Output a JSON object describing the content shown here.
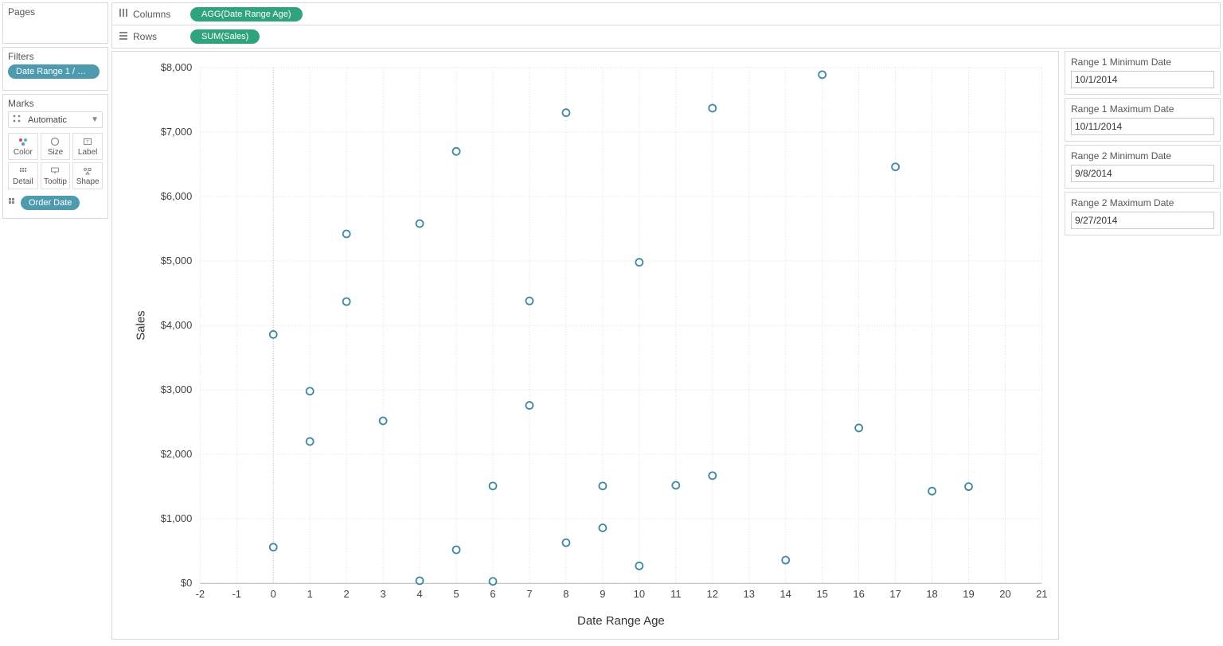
{
  "sidebar": {
    "pages_title": "Pages",
    "filters_title": "Filters",
    "filters_pill": "Date Range 1 / Date ..",
    "marks_title": "Marks",
    "mark_type": "Automatic",
    "cells": {
      "color": "Color",
      "size": "Size",
      "label": "Label",
      "detail": "Detail",
      "tooltip": "Tooltip",
      "shape": "Shape"
    },
    "detail_pill": "Order Date"
  },
  "shelves": {
    "columns_label": "Columns",
    "columns_pill": "AGG(Date Range Age)",
    "rows_label": "Rows",
    "rows_pill": "SUM(Sales)"
  },
  "params": {
    "r1min_label": "Range 1 Minimum Date",
    "r1min_value": "10/1/2014",
    "r1max_label": "Range 1 Maximum Date",
    "r1max_value": "10/11/2014",
    "r2min_label": "Range 2 Minimum Date",
    "r2min_value": "9/8/2014",
    "r2max_label": "Range 2 Maximum Date",
    "r2max_value": "9/27/2014"
  },
  "chart_data": {
    "type": "scatter",
    "xlabel": "Date Range Age",
    "ylabel": "Sales",
    "xlim": [
      -2,
      21
    ],
    "ylim": [
      0,
      8000
    ],
    "x_ticks": [
      -2,
      -1,
      0,
      1,
      2,
      3,
      4,
      5,
      6,
      7,
      8,
      9,
      10,
      11,
      12,
      13,
      14,
      15,
      16,
      17,
      18,
      19,
      20,
      21
    ],
    "y_ticks": [
      0,
      1000,
      2000,
      3000,
      4000,
      5000,
      6000,
      7000,
      8000
    ],
    "y_tick_labels": [
      "$0",
      "$1,000",
      "$2,000",
      "$3,000",
      "$4,000",
      "$5,000",
      "$6,000",
      "$7,000",
      "$8,000"
    ],
    "points": [
      {
        "x": 0,
        "y": 3860
      },
      {
        "x": 0,
        "y": 560
      },
      {
        "x": 1,
        "y": 2980
      },
      {
        "x": 1,
        "y": 2200
      },
      {
        "x": 2,
        "y": 5420
      },
      {
        "x": 2,
        "y": 4370
      },
      {
        "x": 3,
        "y": 2520
      },
      {
        "x": 4,
        "y": 5580
      },
      {
        "x": 4,
        "y": 40
      },
      {
        "x": 5,
        "y": 6700
      },
      {
        "x": 5,
        "y": 520
      },
      {
        "x": 6,
        "y": 1510
      },
      {
        "x": 6,
        "y": 30
      },
      {
        "x": 7,
        "y": 4380
      },
      {
        "x": 7,
        "y": 2760
      },
      {
        "x": 8,
        "y": 7300
      },
      {
        "x": 8,
        "y": 630
      },
      {
        "x": 9,
        "y": 1510
      },
      {
        "x": 9,
        "y": 860
      },
      {
        "x": 10,
        "y": 4980
      },
      {
        "x": 10,
        "y": 270
      },
      {
        "x": 11,
        "y": 1520
      },
      {
        "x": 12,
        "y": 7370
      },
      {
        "x": 12,
        "y": 1670
      },
      {
        "x": 14,
        "y": 360
      },
      {
        "x": 15,
        "y": 7890
      },
      {
        "x": 16,
        "y": 2410
      },
      {
        "x": 17,
        "y": 6460
      },
      {
        "x": 18,
        "y": 1430
      },
      {
        "x": 19,
        "y": 1500
      }
    ]
  }
}
